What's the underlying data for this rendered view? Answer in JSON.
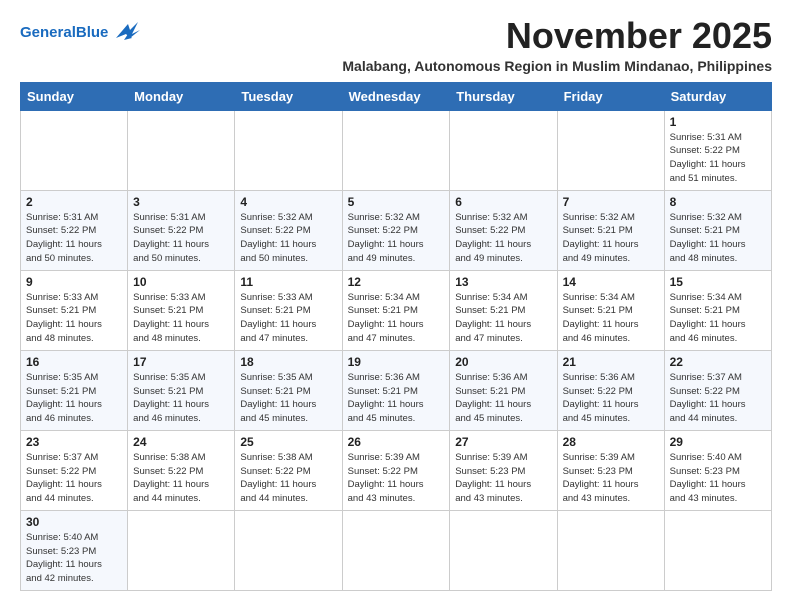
{
  "logo": {
    "general": "General",
    "blue": "Blue",
    "alt": "GeneralBlue logo"
  },
  "header": {
    "month_year": "November 2025",
    "subtitle": "Malabang, Autonomous Region in Muslim Mindanao, Philippines"
  },
  "weekdays": [
    "Sunday",
    "Monday",
    "Tuesday",
    "Wednesday",
    "Thursday",
    "Friday",
    "Saturday"
  ],
  "weeks": [
    [
      {
        "day": "",
        "info": ""
      },
      {
        "day": "",
        "info": ""
      },
      {
        "day": "",
        "info": ""
      },
      {
        "day": "",
        "info": ""
      },
      {
        "day": "",
        "info": ""
      },
      {
        "day": "",
        "info": ""
      },
      {
        "day": "1",
        "info": "Sunrise: 5:31 AM\nSunset: 5:22 PM\nDaylight: 11 hours\nand 51 minutes."
      }
    ],
    [
      {
        "day": "2",
        "info": "Sunrise: 5:31 AM\nSunset: 5:22 PM\nDaylight: 11 hours\nand 50 minutes."
      },
      {
        "day": "3",
        "info": "Sunrise: 5:31 AM\nSunset: 5:22 PM\nDaylight: 11 hours\nand 50 minutes."
      },
      {
        "day": "4",
        "info": "Sunrise: 5:32 AM\nSunset: 5:22 PM\nDaylight: 11 hours\nand 50 minutes."
      },
      {
        "day": "5",
        "info": "Sunrise: 5:32 AM\nSunset: 5:22 PM\nDaylight: 11 hours\nand 49 minutes."
      },
      {
        "day": "6",
        "info": "Sunrise: 5:32 AM\nSunset: 5:22 PM\nDaylight: 11 hours\nand 49 minutes."
      },
      {
        "day": "7",
        "info": "Sunrise: 5:32 AM\nSunset: 5:21 PM\nDaylight: 11 hours\nand 49 minutes."
      },
      {
        "day": "8",
        "info": "Sunrise: 5:32 AM\nSunset: 5:21 PM\nDaylight: 11 hours\nand 48 minutes."
      }
    ],
    [
      {
        "day": "9",
        "info": "Sunrise: 5:33 AM\nSunset: 5:21 PM\nDaylight: 11 hours\nand 48 minutes."
      },
      {
        "day": "10",
        "info": "Sunrise: 5:33 AM\nSunset: 5:21 PM\nDaylight: 11 hours\nand 48 minutes."
      },
      {
        "day": "11",
        "info": "Sunrise: 5:33 AM\nSunset: 5:21 PM\nDaylight: 11 hours\nand 47 minutes."
      },
      {
        "day": "12",
        "info": "Sunrise: 5:34 AM\nSunset: 5:21 PM\nDaylight: 11 hours\nand 47 minutes."
      },
      {
        "day": "13",
        "info": "Sunrise: 5:34 AM\nSunset: 5:21 PM\nDaylight: 11 hours\nand 47 minutes."
      },
      {
        "day": "14",
        "info": "Sunrise: 5:34 AM\nSunset: 5:21 PM\nDaylight: 11 hours\nand 46 minutes."
      },
      {
        "day": "15",
        "info": "Sunrise: 5:34 AM\nSunset: 5:21 PM\nDaylight: 11 hours\nand 46 minutes."
      }
    ],
    [
      {
        "day": "16",
        "info": "Sunrise: 5:35 AM\nSunset: 5:21 PM\nDaylight: 11 hours\nand 46 minutes."
      },
      {
        "day": "17",
        "info": "Sunrise: 5:35 AM\nSunset: 5:21 PM\nDaylight: 11 hours\nand 46 minutes."
      },
      {
        "day": "18",
        "info": "Sunrise: 5:35 AM\nSunset: 5:21 PM\nDaylight: 11 hours\nand 45 minutes."
      },
      {
        "day": "19",
        "info": "Sunrise: 5:36 AM\nSunset: 5:21 PM\nDaylight: 11 hours\nand 45 minutes."
      },
      {
        "day": "20",
        "info": "Sunrise: 5:36 AM\nSunset: 5:21 PM\nDaylight: 11 hours\nand 45 minutes."
      },
      {
        "day": "21",
        "info": "Sunrise: 5:36 AM\nSunset: 5:22 PM\nDaylight: 11 hours\nand 45 minutes."
      },
      {
        "day": "22",
        "info": "Sunrise: 5:37 AM\nSunset: 5:22 PM\nDaylight: 11 hours\nand 44 minutes."
      }
    ],
    [
      {
        "day": "23",
        "info": "Sunrise: 5:37 AM\nSunset: 5:22 PM\nDaylight: 11 hours\nand 44 minutes."
      },
      {
        "day": "24",
        "info": "Sunrise: 5:38 AM\nSunset: 5:22 PM\nDaylight: 11 hours\nand 44 minutes."
      },
      {
        "day": "25",
        "info": "Sunrise: 5:38 AM\nSunset: 5:22 PM\nDaylight: 11 hours\nand 44 minutes."
      },
      {
        "day": "26",
        "info": "Sunrise: 5:39 AM\nSunset: 5:22 PM\nDaylight: 11 hours\nand 43 minutes."
      },
      {
        "day": "27",
        "info": "Sunrise: 5:39 AM\nSunset: 5:23 PM\nDaylight: 11 hours\nand 43 minutes."
      },
      {
        "day": "28",
        "info": "Sunrise: 5:39 AM\nSunset: 5:23 PM\nDaylight: 11 hours\nand 43 minutes."
      },
      {
        "day": "29",
        "info": "Sunrise: 5:40 AM\nSunset: 5:23 PM\nDaylight: 11 hours\nand 43 minutes."
      }
    ],
    [
      {
        "day": "30",
        "info": "Sunrise: 5:40 AM\nSunset: 5:23 PM\nDaylight: 11 hours\nand 42 minutes."
      },
      {
        "day": "",
        "info": ""
      },
      {
        "day": "",
        "info": ""
      },
      {
        "day": "",
        "info": ""
      },
      {
        "day": "",
        "info": ""
      },
      {
        "day": "",
        "info": ""
      },
      {
        "day": "",
        "info": ""
      }
    ]
  ]
}
